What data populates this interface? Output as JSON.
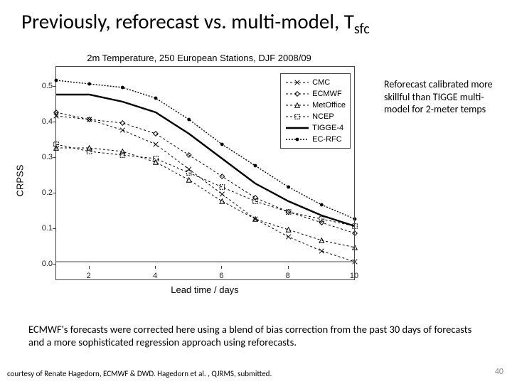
{
  "title_main": "Previously, reforecast vs. multi-model, T",
  "title_sub": "sfc",
  "annotation": "Reforecast calibrated more skillful than TIGGE multi-model for 2-meter temps",
  "caption": "ECMWF's forecasts were corrected here using a blend of bias correction from the past 30 days of forecasts and a more sophisticated regression approach using reforecasts.",
  "credit": "courtesy of Renate Hagedorn, ECMWF & DWD.  Hagedorn et al. , QJRMS, submitted.",
  "page_number": "40",
  "chart_data": {
    "type": "line",
    "title": "2m Temperature, 250 European Stations, DJF 2008/09",
    "xlabel": "Lead time / days",
    "ylabel": "CRPSS",
    "x": [
      1,
      2,
      3,
      4,
      5,
      6,
      7,
      8,
      9,
      10
    ],
    "xlim": [
      1,
      10
    ],
    "ylim": [
      -0.05,
      0.55
    ],
    "yticks": [
      0.0,
      0.1,
      0.2,
      0.3,
      0.4,
      0.5
    ],
    "xticks": [
      2,
      4,
      6,
      8,
      10
    ],
    "series": [
      {
        "name": "CMC",
        "marker": "x",
        "dash": "3,3",
        "weight": 1,
        "values": [
          0.41,
          0.4,
          0.37,
          0.33,
          0.26,
          0.19,
          0.12,
          0.07,
          0.03,
          0.0
        ]
      },
      {
        "name": "ECMWF",
        "marker": "diamond",
        "dash": "3,3",
        "weight": 1,
        "values": [
          0.42,
          0.4,
          0.39,
          0.36,
          0.3,
          0.24,
          0.18,
          0.14,
          0.11,
          0.08
        ]
      },
      {
        "name": "MetOffice",
        "marker": "triangle",
        "dash": "3,3",
        "weight": 1,
        "values": [
          0.32,
          0.32,
          0.31,
          0.28,
          0.23,
          0.17,
          0.12,
          0.09,
          0.06,
          0.04
        ]
      },
      {
        "name": "NCEP",
        "marker": "square",
        "dash": "3,3",
        "weight": 1,
        "values": [
          0.33,
          0.31,
          0.3,
          0.29,
          0.25,
          0.21,
          0.17,
          0.14,
          0.12,
          0.1
        ]
      },
      {
        "name": "TIGGE-4",
        "marker": "none",
        "dash": "",
        "weight": 2.4,
        "values": [
          0.47,
          0.47,
          0.45,
          0.42,
          0.36,
          0.29,
          0.22,
          0.17,
          0.13,
          0.1
        ]
      },
      {
        "name": "EC-RFC",
        "marker": "dot",
        "dash": "2,2",
        "weight": 1.4,
        "values": [
          0.51,
          0.5,
          0.49,
          0.46,
          0.4,
          0.33,
          0.27,
          0.21,
          0.16,
          0.12
        ]
      }
    ]
  }
}
